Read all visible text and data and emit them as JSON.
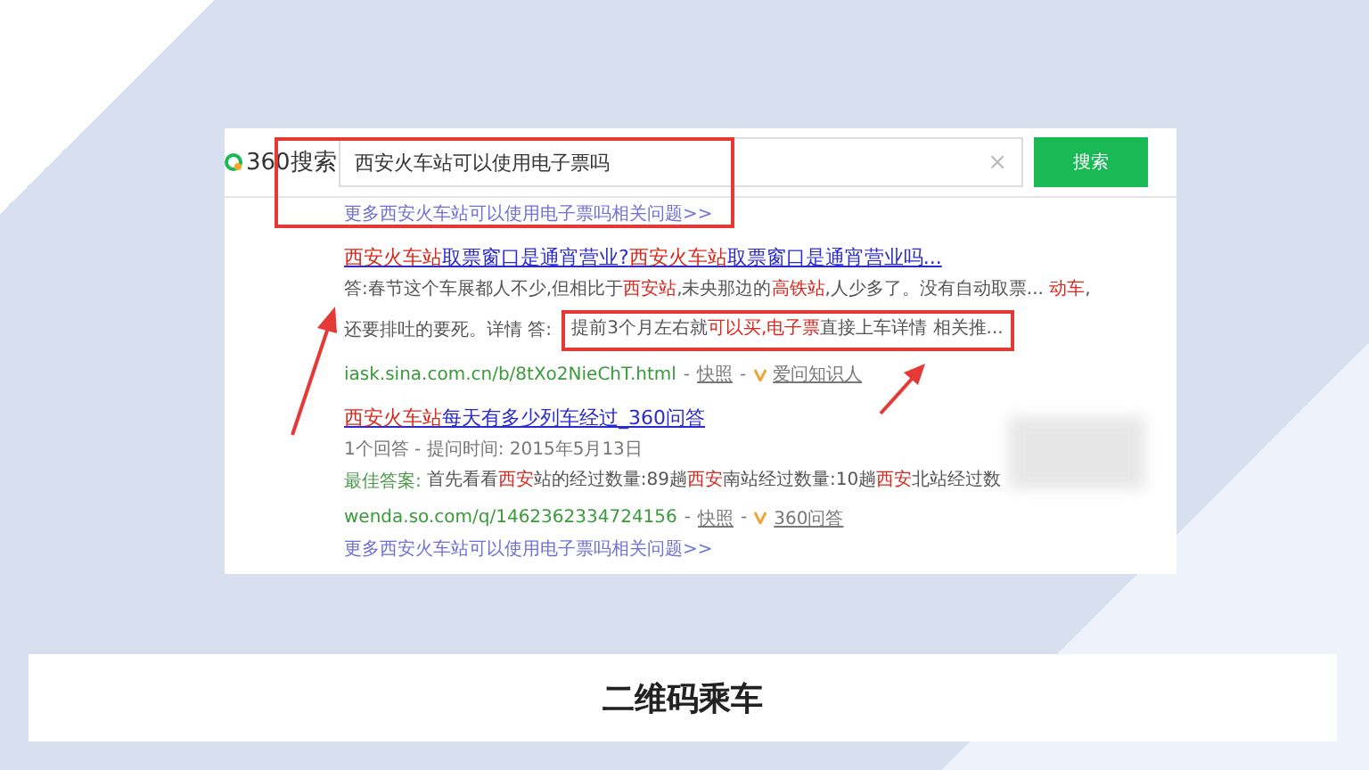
{
  "search": {
    "logo": "360搜索",
    "query": "西安火车站可以使用电子票吗",
    "clear": "×",
    "button": "搜索",
    "related_link": "更多西安火车站可以使用电子票吗相关问题>>"
  },
  "results": [
    {
      "title": [
        {
          "t": "西安火车站",
          "hl": true
        },
        {
          "t": "取票窗口是通宵营业?",
          "hl": false
        },
        {
          "t": "西安火车站",
          "hl": true
        },
        {
          "t": "取票窗口是通宵营业吗...",
          "hl": false
        }
      ],
      "snippet_lines": [
        [
          {
            "t": "答:春节这个车展都人不少,但相比于",
            "hl": false
          },
          {
            "t": "西安站",
            "hl": true
          },
          {
            "t": ",未央那边的",
            "hl": false
          },
          {
            "t": "高铁站",
            "hl": true
          },
          {
            "t": ",人少多了。没有自动取票... ",
            "hl": false
          },
          {
            "t": "动车",
            "hl": true
          },
          {
            "t": ",",
            "hl": false
          }
        ],
        [
          {
            "t": "还要排吐的要死。详情 答:",
            "hl": false
          }
        ]
      ],
      "answer": [
        {
          "t": "提前3个月左右就",
          "hl": false
        },
        {
          "t": "可以买,",
          "hl": true
        },
        {
          "t": "电子票",
          "hl": true
        },
        {
          "t": "直接上车详情 相关推...",
          "hl": false
        }
      ],
      "url": "iask.sina.com.cn/b/8tXo2NieChT.html",
      "sep": "-",
      "snapshot": "快照",
      "source": "爱问知识人"
    },
    {
      "title": [
        {
          "t": "西安火车站",
          "hl": true
        },
        {
          "t": "每天有多少列车经过_360问答",
          "hl": false
        }
      ],
      "meta": "1个回答 - 提问时间: 2015年5月13日",
      "best_label": "最佳答案:",
      "snippet_lines": [
        [
          {
            "t": "首先看看",
            "hl": false
          },
          {
            "t": "西安",
            "hl": true
          },
          {
            "t": "站的经过数量:89趟",
            "hl": false
          },
          {
            "t": "西安",
            "hl": true
          },
          {
            "t": "南站经过数量:10趟",
            "hl": false
          },
          {
            "t": "西安",
            "hl": true
          },
          {
            "t": "北站经过数",
            "hl": false
          }
        ]
      ],
      "url": "wenda.so.com/q/1462362334724156",
      "sep": "-",
      "snapshot": "快照",
      "source": "360问答",
      "more": "更多西安火车站可以使用电子票吗相关问题>>"
    }
  ],
  "caption": "二维码乘车"
}
